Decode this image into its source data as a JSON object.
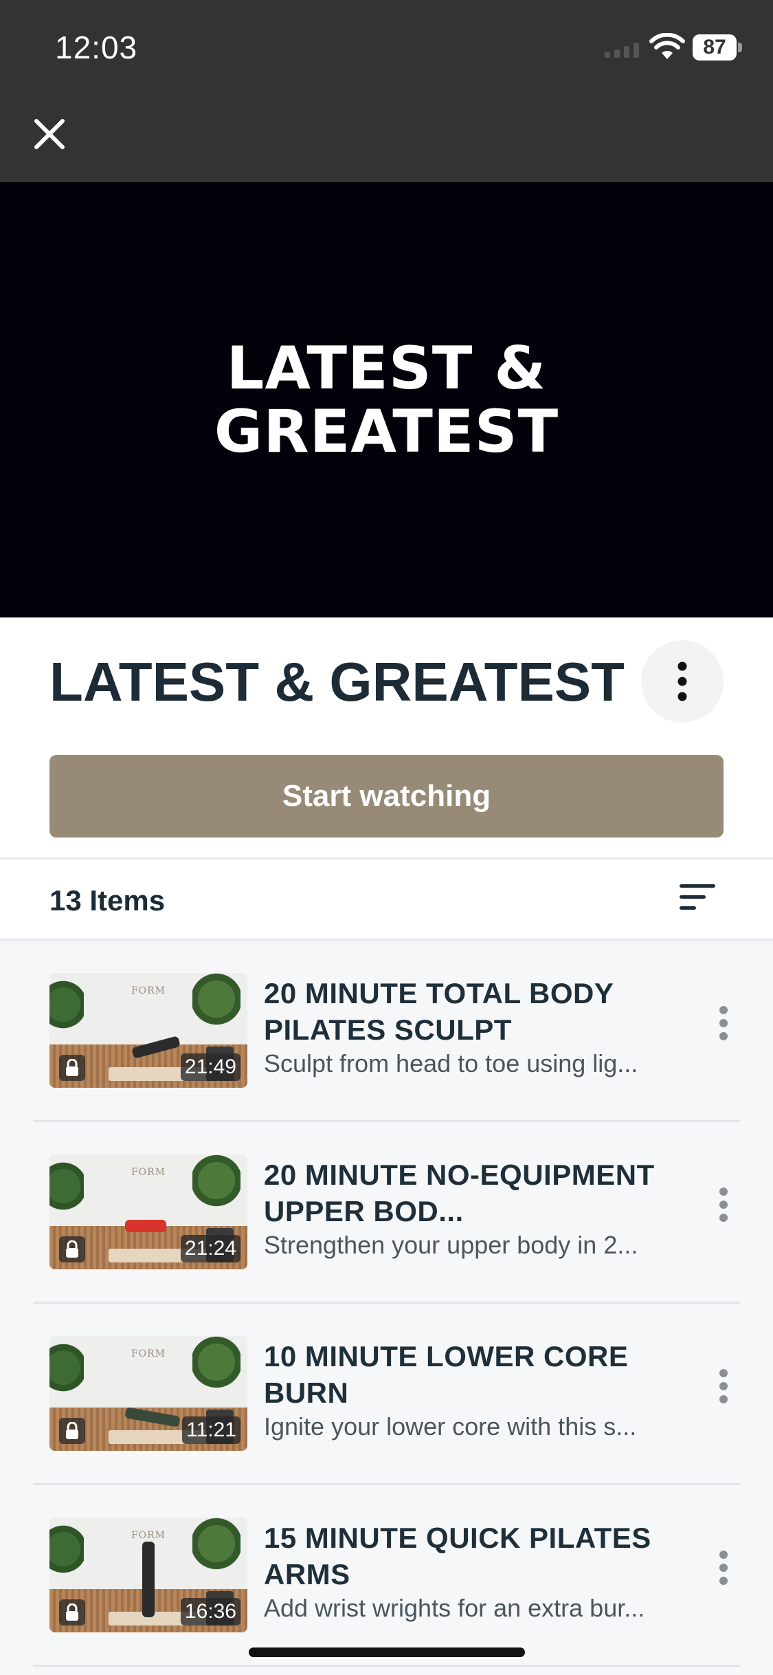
{
  "status_bar": {
    "time": "12:03",
    "battery": "87"
  },
  "hero": {
    "title": "LATEST & GREATEST"
  },
  "header": {
    "title": "LATEST & GREATEST",
    "start_label": "Start watching"
  },
  "items_bar": {
    "count_label": "13 Items"
  },
  "items": [
    {
      "title": "20 MINUTE TOTAL BODY PILATES SCULPT",
      "description": "Sculpt from head to toe using lig...",
      "duration": "21:49",
      "thumb_brand": "FORM"
    },
    {
      "title": "20 MINUTE NO-EQUIPMENT UPPER BOD...",
      "description": "Strengthen your upper body in 2...",
      "duration": "21:24",
      "thumb_brand": "FORM"
    },
    {
      "title": "10 MINUTE LOWER CORE BURN",
      "description": "Ignite your lower core with this s...",
      "duration": "11:21",
      "thumb_brand": "FORM"
    },
    {
      "title": "15 MINUTE QUICK PILATES ARMS",
      "description": "Add wrist wrights for an extra bur...",
      "duration": "16:36",
      "thumb_brand": "FORM"
    }
  ],
  "colors": {
    "accent": "#978b78",
    "dark": "#333333",
    "hero_bg": "#03020a",
    "text": "#1c2b36"
  }
}
